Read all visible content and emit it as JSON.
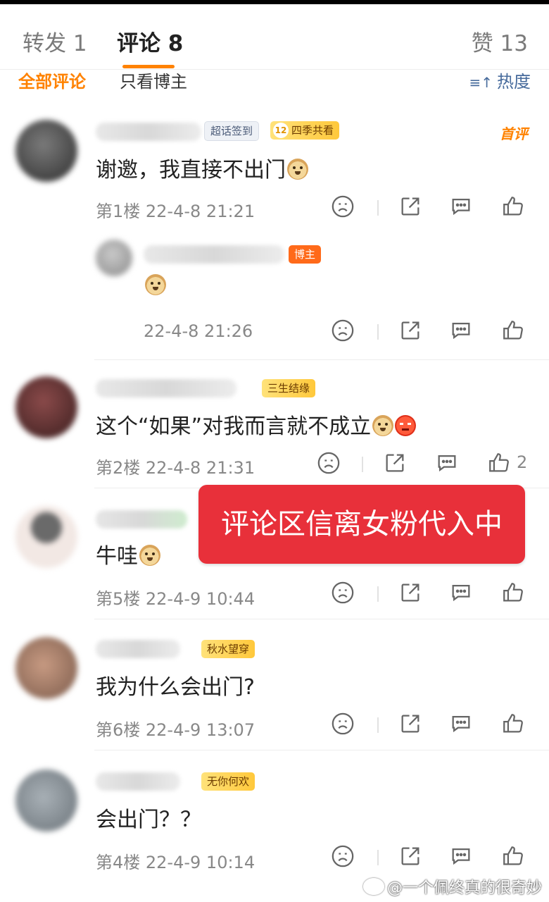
{
  "tabs": [
    {
      "label": "转发 1"
    },
    {
      "label": "评论 8"
    },
    {
      "label": "赞 13"
    }
  ],
  "filters": {
    "all": "全部评论",
    "blogger_only": "只看博主",
    "sort": "热度"
  },
  "comments": [
    {
      "badges": [
        "超话签到",
        "四季共看"
      ],
      "badge_num": "12",
      "first_tag": "首评",
      "text": "谢邀，我直接不出门",
      "floor_time": "第1楼  22-4-8 21:21"
    },
    {
      "badges": [
        "博主"
      ],
      "text": "",
      "floor_time": "22-4-8 21:26"
    },
    {
      "badges": [
        "三生结缘"
      ],
      "text": "这个“如果”对我而言就不成立",
      "floor_time": "第2楼  22-4-8 21:31",
      "likes": "2"
    },
    {
      "text": "牛哇",
      "floor_time": "第5楼  22-4-9 10:44"
    },
    {
      "badges": [
        "秋水望穿"
      ],
      "text": "我为什么会出门?",
      "floor_time": "第6楼  22-4-9 13:07"
    },
    {
      "badges": [
        "无你何欢"
      ],
      "text": "会出门？？",
      "floor_time": "第4楼  22-4-9 10:14"
    }
  ],
  "overlay_text": "评论区信离女粉代入中",
  "watermark": "@一个佩终真的很奇妙",
  "colors": {
    "accent": "#ff8200",
    "overlay": "#e8303a",
    "sort": "#476b9c"
  }
}
